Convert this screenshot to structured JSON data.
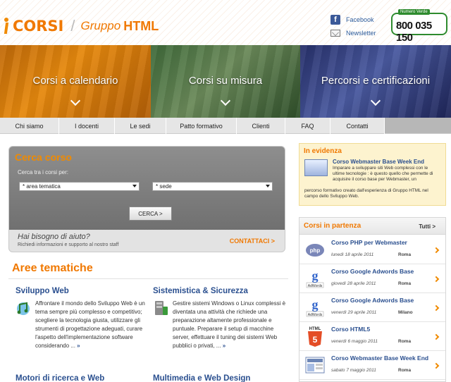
{
  "header": {
    "logo_corsi": "CORSI",
    "logo_sep": "/",
    "logo_gruppo": "Gruppo",
    "logo_html": "HTML",
    "facebook_label": "Facebook",
    "newsletter_label": "Newsletter",
    "phone_label": "Numero Verde",
    "phone_number": "800 035 150"
  },
  "banner": {
    "panels": [
      {
        "title": "Corsi a calendario"
      },
      {
        "title": "Corsi su misura"
      },
      {
        "title": "Percorsi e certificazioni"
      }
    ]
  },
  "nav": {
    "items": [
      {
        "label": "Chi siamo"
      },
      {
        "label": "I docenti"
      },
      {
        "label": "Le sedi"
      },
      {
        "label": "Patto formativo"
      },
      {
        "label": "Clienti"
      },
      {
        "label": "FAQ"
      },
      {
        "label": "Contatti"
      }
    ]
  },
  "search": {
    "title": "Cerca corso",
    "subtitle": "Cerca tra i corsi per:",
    "select_area": "* area tematica",
    "select_sede": "* sede",
    "button": "CERCA >",
    "help_question": "Hai bisogno di aiuto?",
    "help_text": "Richiedi informazioni e supporto al nostro staff",
    "contact": "CONTATTACI >"
  },
  "aree": {
    "title": "Aree tematiche",
    "items": [
      {
        "title": "Sviluppo Web",
        "text": "Affrontare il mondo dello Sviluppo Web è un tema sempre più complesso e competitivo; scegliere la tecnologia giusta, utilizzare gli strumenti di progettazione adeguati, curare l'aspetto dell'implementazione software considerando ...",
        "more": "»"
      },
      {
        "title": "Sistemistica & Sicurezza",
        "text": "Gestire sistemi Windows o Linux complessi è diventata una attività che richiede una preparazione altamente professionale e puntuale. Preparare il setup di macchine server, effettuare il tuning dei sistemi Web pubblici o privati, ...",
        "more": "»"
      }
    ],
    "next_left": "Motori di ricerca e Web",
    "next_right": "Multimedia e Web Design"
  },
  "evidenza": {
    "title": "In evidenza",
    "course": "Corso Webmaster Base Week End",
    "text": "Imparare a sviluppare siti Web complessi con le ultime tecnologie : è questo quello che permette di acquisire il corso base per Webmaster, un",
    "text2": "percorso formativo creato dall'esperienza di Gruppo HTML nel campo dello Sviluppo Web."
  },
  "partenza": {
    "title": "Corsi in partenza",
    "all": "Tutti >",
    "courses": [
      {
        "name": "Corso PHP per Webmaster",
        "date": "lunedì 18 aprile 2011",
        "city": "Roma",
        "icon": "php-icon"
      },
      {
        "name": "Corso Google Adwords Base",
        "date": "giovedì 28 aprile 2011",
        "city": "Roma",
        "icon": "adwords-icon"
      },
      {
        "name": "Corso Google Adwords Base",
        "date": "venerdì 29 aprile 2011",
        "city": "Milano",
        "icon": "adwords-icon"
      },
      {
        "name": "Corso HTML5",
        "date": "venerdì 6 maggio 2011",
        "city": "Roma",
        "icon": "html5-icon"
      },
      {
        "name": "Corso Webmaster Base Week End",
        "date": "sabato 7 maggio 2011",
        "city": "Roma",
        "icon": "webmaster-icon"
      }
    ]
  }
}
